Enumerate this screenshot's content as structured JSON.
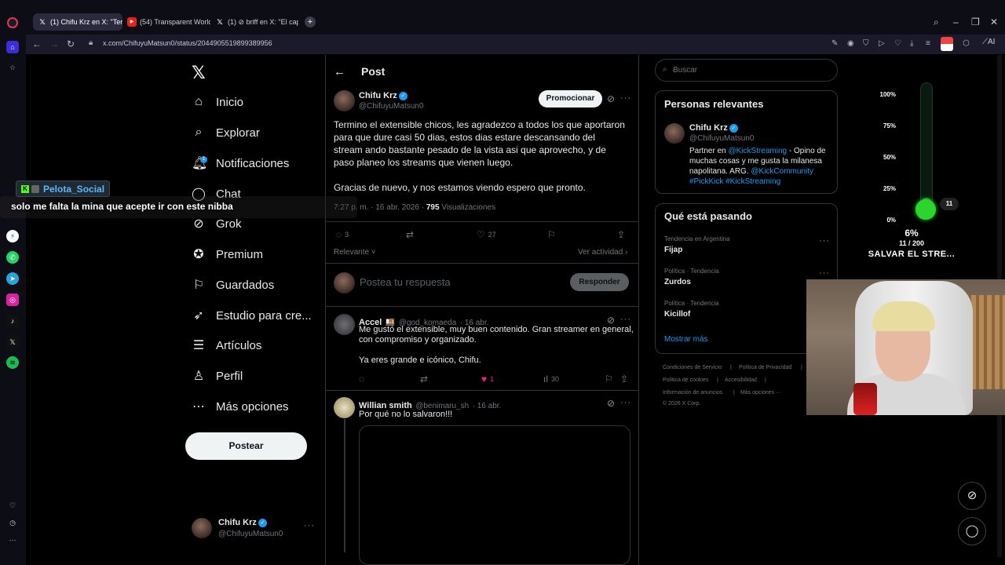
{
  "browser": {
    "tabs": [
      {
        "label": "(1) Chifu Krz en X: \"Termin",
        "favicon": "x-logo-icon",
        "active": true
      },
      {
        "label": "(54) Transparent World – A",
        "favicon": "youtube-icon",
        "active": false
      },
      {
        "label": "(1) ⊘ briff en X: \"El capítul",
        "favicon": "x-logo-icon",
        "active": false
      }
    ],
    "url": "x.com/ChifuyuMatsun0/status/2044905519899389956",
    "ai_label": "AI"
  },
  "nav": {
    "items": [
      {
        "label": "Inicio",
        "icon": "home-icon"
      },
      {
        "label": "Explorar",
        "icon": "search-icon"
      },
      {
        "label": "Notificaciones",
        "icon": "bell-icon",
        "badge": "1"
      },
      {
        "label": "Chat",
        "icon": "chat-icon"
      },
      {
        "label": "Grok",
        "icon": "grok-icon"
      },
      {
        "label": "Premium",
        "icon": "premium-icon"
      },
      {
        "label": "Guardados",
        "icon": "bookmark-icon"
      },
      {
        "label": "Estudio para cre...",
        "icon": "rocket-icon"
      },
      {
        "label": "Artículos",
        "icon": "articles-icon"
      },
      {
        "label": "Perfil",
        "icon": "person-icon"
      },
      {
        "label": "Más opciones",
        "icon": "more-circle-icon"
      }
    ],
    "post_button": "Postear",
    "account": {
      "name": "Chifu Krz",
      "handle": "@ChifuyuMatsun0"
    }
  },
  "post": {
    "header_title": "Post",
    "author": {
      "name": "Chifu Krz",
      "handle": "@ChifuyuMatsun0"
    },
    "promote_label": "Promocionar",
    "text": "Termino el extensible chicos, les agradezco a todos los que aportaron para que dure casi 50 dias, estos dias estare descansando del stream ando bastante pesado de la vista asi que aprovecho, y de paso planeo los streams que vienen luego.\n\nGracias de nuevo, y nos estamos viendo espero que pronto.",
    "time_date": "7:27 p. m. · 16 abr. 2026 ·",
    "views_count": "795",
    "views_label": "Visualizaciones",
    "replies": "3",
    "likes": "27",
    "sort_label": "Relevante",
    "activity_label": "Ver actividad",
    "reply_placeholder": "Postea tu respuesta",
    "reply_button": "Responder"
  },
  "replies": [
    {
      "name": "Accel",
      "handle": "@god_komaeda",
      "date": "· 16 abr.",
      "text": "Me gustó el extensible, muy buen contenido. Gran streamer en general, con compromiso y organizado.\n\nYa eres grande e icónico, Chifu.",
      "replies": "",
      "likes": "1",
      "views": "30"
    },
    {
      "name": "Willian smith",
      "handle": "@benimaru_sh",
      "date": "· 16 abr.",
      "text": "Por qué no lo salvaron!!!"
    }
  ],
  "search": {
    "placeholder": "Buscar"
  },
  "relevant": {
    "title": "Personas relevantes",
    "name": "Chifu Krz",
    "handle": "@ChifuyuMatsun0",
    "bio_1": "Partner en ",
    "bio_link1": "@KickStreaming",
    "bio_2": " - Opino de muchas cosas y me gusta la milanesa napolitana. ARG. ",
    "bio_link2": "@KickCommunity",
    "bio_link3": "#PickKick #KickStreaming"
  },
  "trends": {
    "title": "Qué está pasando",
    "items": [
      {
        "meta": "Tendencia en Argentina",
        "name": "Fijap"
      },
      {
        "meta": "Política · Tendencia",
        "name": "Zurdos"
      },
      {
        "meta": "Política · Tendencia",
        "name": "Kicillof"
      }
    ],
    "show_more": "Mostrar más"
  },
  "footer": {
    "links": [
      "Condiciones de Servicio",
      "Política de Privacidad",
      "Política de cookies",
      "Accesibilidad",
      "Información de anuncios",
      "Más opciones ···"
    ],
    "copyright": "© 2026 X Corp."
  },
  "overlay": {
    "username": "Pelota_Social",
    "message": "solo me falta la mina que acepte ir con este nibba"
  },
  "goal": {
    "labels": [
      "100%",
      "75%",
      "50%",
      "25%",
      "0%"
    ],
    "count_badge": "11",
    "percent_text": "6%",
    "progress_text": "11 / 200",
    "title": "SALVAR EL STRE...",
    "progress_fraction": 0.055
  },
  "colors": {
    "accent": "#1d9bf0",
    "kick_green": "#53fc18",
    "like_pink": "#f91880"
  }
}
